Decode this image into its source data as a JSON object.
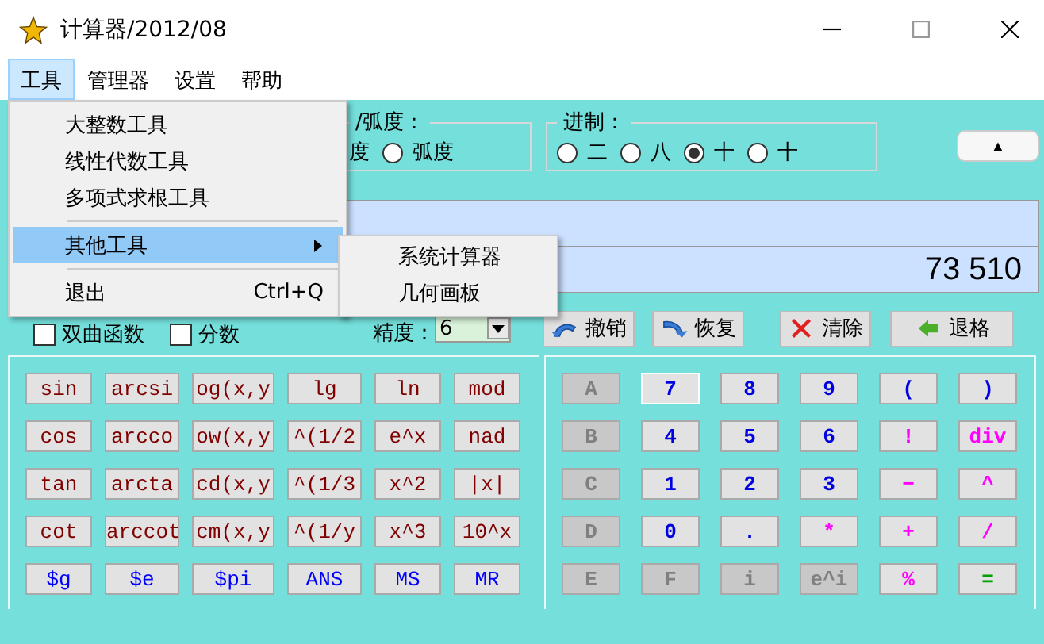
{
  "window": {
    "title": "计算器/2012/08"
  },
  "menubar": [
    {
      "label": "工具",
      "selected": true
    },
    {
      "label": "管理器",
      "selected": false
    },
    {
      "label": "设置",
      "selected": false
    },
    {
      "label": "帮助",
      "selected": false
    }
  ],
  "menu": {
    "items": [
      {
        "kind": "item",
        "label": "大整数工具",
        "selected": false
      },
      {
        "kind": "item",
        "label": "线性代数工具",
        "selected": false
      },
      {
        "kind": "item",
        "label": "多项式求根工具",
        "selected": false
      },
      {
        "kind": "separator"
      },
      {
        "kind": "submenu",
        "label": "其他工具",
        "selected": true
      },
      {
        "kind": "separator"
      },
      {
        "kind": "item",
        "label": "退出",
        "shortcut": "Ctrl+Q",
        "selected": false
      }
    ],
    "submenu": [
      {
        "label": "系统计算器"
      },
      {
        "label": "几何画板"
      }
    ]
  },
  "angle_group": {
    "legend": "/弧度：",
    "options": [
      {
        "label": "度"
      },
      {
        "label": "弧度",
        "selected": false
      }
    ]
  },
  "base_group": {
    "legend": "进制：",
    "options": [
      {
        "label": "二",
        "selected": false
      },
      {
        "label": "八",
        "selected": false
      },
      {
        "label": "十",
        "selected": true
      },
      {
        "label": "十",
        "selected": false
      }
    ]
  },
  "collapse_button": "▲",
  "display": {
    "result": "73 510"
  },
  "options": {
    "checkboxes": [
      {
        "label": "双曲函数",
        "checked": false
      },
      {
        "label": "分数",
        "checked": false
      }
    ],
    "precision_label": "精度：",
    "precision": "6"
  },
  "actions": [
    {
      "kind": "undo",
      "label": "撤销"
    },
    {
      "kind": "redo",
      "label": "恢复"
    },
    {
      "kind": "clear",
      "label": "清除"
    },
    {
      "kind": "back",
      "label": "退格"
    }
  ],
  "function_keys": [
    [
      {
        "label": "sin",
        "kind": "func"
      },
      {
        "label": "arcsi",
        "kind": "func"
      },
      {
        "label": "og(x,y",
        "kind": "func"
      },
      {
        "label": "lg",
        "kind": "func"
      },
      {
        "label": "ln",
        "kind": "func"
      },
      {
        "label": "mod",
        "kind": "func"
      }
    ],
    [
      {
        "label": "cos",
        "kind": "func"
      },
      {
        "label": "arcco",
        "kind": "func"
      },
      {
        "label": "ow(x,y",
        "kind": "func"
      },
      {
        "label": "^(1/2",
        "kind": "func"
      },
      {
        "label": "e^x",
        "kind": "func"
      },
      {
        "label": "nad",
        "kind": "func"
      }
    ],
    [
      {
        "label": "tan",
        "kind": "func"
      },
      {
        "label": "arcta",
        "kind": "func"
      },
      {
        "label": "cd(x,y",
        "kind": "func"
      },
      {
        "label": "^(1/3",
        "kind": "func"
      },
      {
        "label": "x^2",
        "kind": "func"
      },
      {
        "label": "|x|",
        "kind": "func"
      }
    ],
    [
      {
        "label": "cot",
        "kind": "func"
      },
      {
        "label": "arccot",
        "kind": "func"
      },
      {
        "label": "cm(x,y",
        "kind": "func"
      },
      {
        "label": "^(1/y",
        "kind": "func"
      },
      {
        "label": "x^3",
        "kind": "func"
      },
      {
        "label": "10^x",
        "kind": "func"
      }
    ],
    [
      {
        "label": "$g",
        "kind": "const"
      },
      {
        "label": "$e",
        "kind": "const"
      },
      {
        "label": "$pi",
        "kind": "const"
      },
      {
        "label": "ANS",
        "kind": "const"
      },
      {
        "label": "MS",
        "kind": "const"
      },
      {
        "label": "MR",
        "kind": "const"
      }
    ]
  ],
  "number_keys": [
    [
      {
        "label": "A",
        "kind": "digit",
        "disabled": true,
        "focused": false
      },
      {
        "label": "7",
        "kind": "digit",
        "disabled": false,
        "focused": true
      },
      {
        "label": "8",
        "kind": "digit",
        "disabled": false,
        "focused": false
      },
      {
        "label": "9",
        "kind": "digit",
        "disabled": false,
        "focused": false
      },
      {
        "label": "(",
        "kind": "digit",
        "disabled": false,
        "focused": false
      },
      {
        "label": ")",
        "kind": "digit",
        "disabled": false,
        "focused": false
      }
    ],
    [
      {
        "label": "B",
        "kind": "digit",
        "disabled": true,
        "focused": false
      },
      {
        "label": "4",
        "kind": "digit",
        "disabled": false,
        "focused": false
      },
      {
        "label": "5",
        "kind": "digit",
        "disabled": false,
        "focused": false
      },
      {
        "label": "6",
        "kind": "digit",
        "disabled": false,
        "focused": false
      },
      {
        "label": "!",
        "kind": "op",
        "disabled": false,
        "focused": false
      },
      {
        "label": "div",
        "kind": "op",
        "disabled": false,
        "focused": false
      }
    ],
    [
      {
        "label": "C",
        "kind": "digit",
        "disabled": true,
        "focused": false
      },
      {
        "label": "1",
        "kind": "digit",
        "disabled": false,
        "focused": false
      },
      {
        "label": "2",
        "kind": "digit",
        "disabled": false,
        "focused": false
      },
      {
        "label": "3",
        "kind": "digit",
        "disabled": false,
        "focused": false
      },
      {
        "label": "−",
        "kind": "op",
        "disabled": false,
        "focused": false
      },
      {
        "label": "^",
        "kind": "op",
        "disabled": false,
        "focused": false
      }
    ],
    [
      {
        "label": "D",
        "kind": "digit",
        "disabled": true,
        "focused": false
      },
      {
        "label": "0",
        "kind": "digit",
        "disabled": false,
        "focused": false
      },
      {
        "label": ".",
        "kind": "digit",
        "disabled": false,
        "focused": false
      },
      {
        "label": "*",
        "kind": "op",
        "disabled": false,
        "focused": false
      },
      {
        "label": "+",
        "kind": "op",
        "disabled": false,
        "focused": false
      },
      {
        "label": "/",
        "kind": "op",
        "disabled": false,
        "focused": false
      }
    ],
    [
      {
        "label": "E",
        "kind": "digit",
        "disabled": true,
        "focused": false
      },
      {
        "label": "F",
        "kind": "digit",
        "disabled": true,
        "focused": false
      },
      {
        "label": "i",
        "kind": "digit",
        "disabled": true,
        "focused": false
      },
      {
        "label": "e^i",
        "kind": "digit",
        "disabled": true,
        "focused": false
      },
      {
        "label": "%",
        "kind": "op",
        "disabled": false,
        "focused": false
      },
      {
        "label": "=",
        "kind": "equals",
        "disabled": false,
        "focused": false
      }
    ]
  ]
}
